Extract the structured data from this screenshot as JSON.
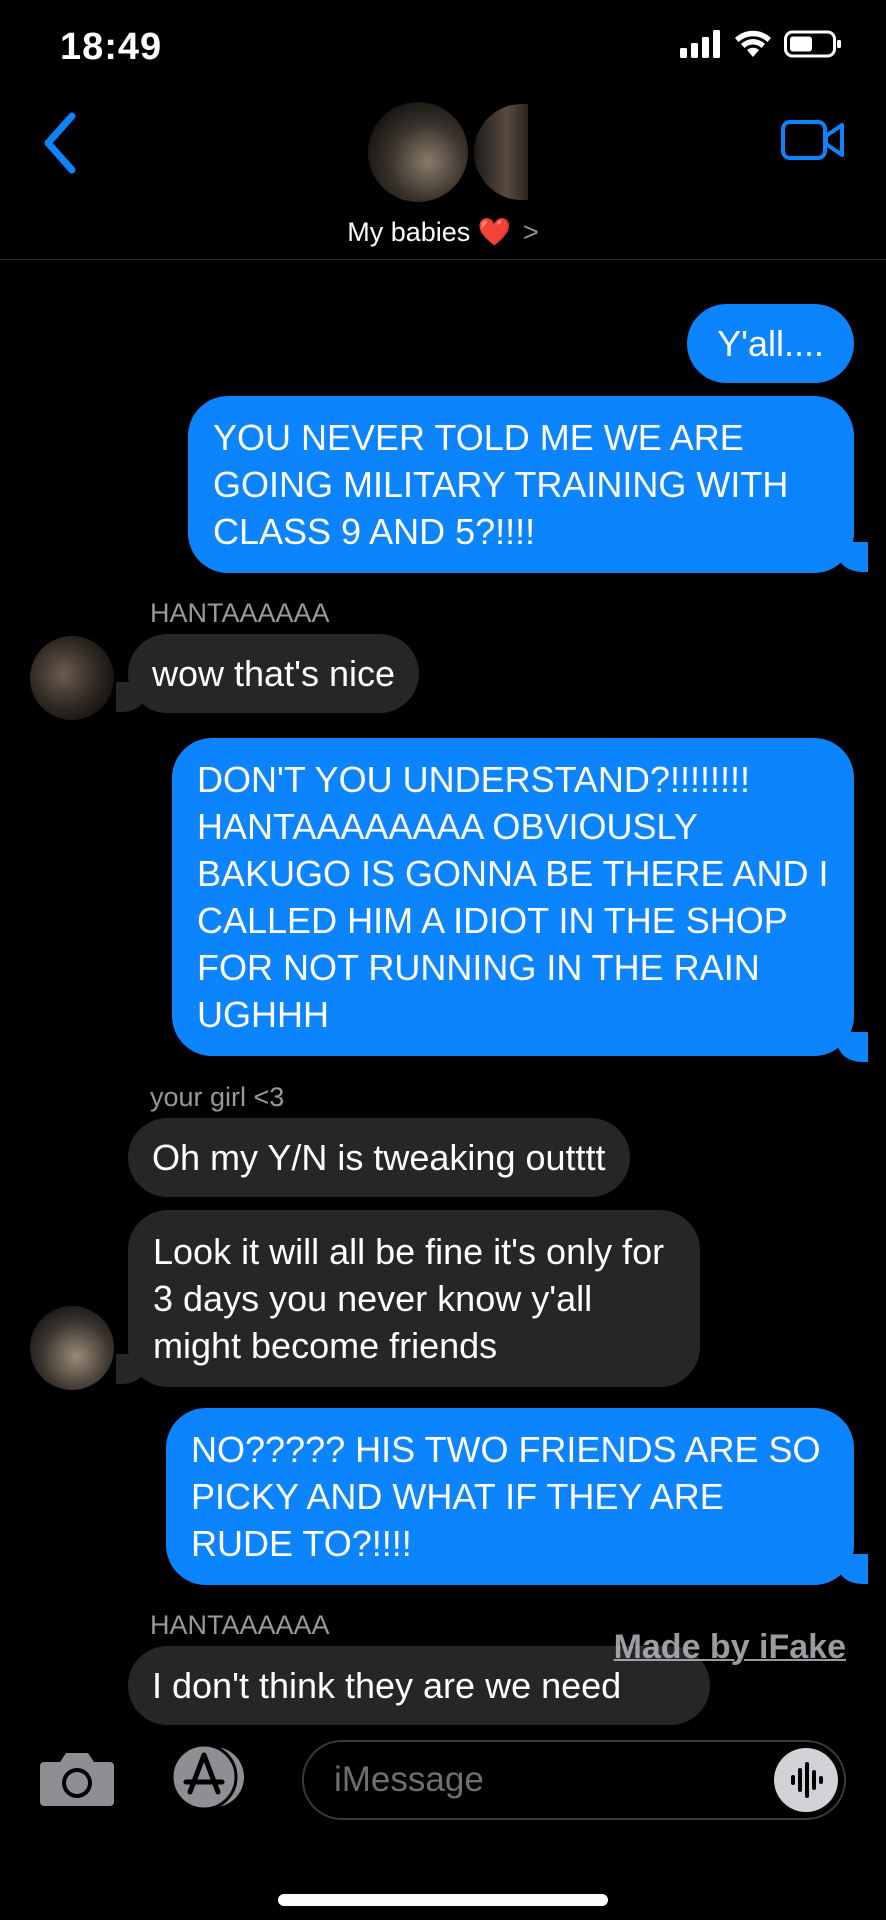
{
  "status_bar": {
    "time": "18:49"
  },
  "header": {
    "group_name": "My babies",
    "heart": "❤️",
    "chevron": ">"
  },
  "messages": [
    {
      "type": "out",
      "text": "Y'all...."
    },
    {
      "type": "out",
      "text": "YOU NEVER TOLD ME WE ARE GOING MILITARY TRAINING WITH CLASS 9 AND 5?!!!!"
    },
    {
      "type": "in",
      "sender": "HANTAAAAAA",
      "text": "wow that's nice"
    },
    {
      "type": "out",
      "text": "DON'T YOU UNDERSTAND?!!!!!!!! HANTAAAAAAAA OBVIOUSLY BAKUGO IS GONNA BE THERE AND I CALLED HIM A IDIOT IN THE SHOP FOR NOT RUNNING IN THE RAIN UGHHH"
    },
    {
      "type": "in",
      "sender": "your girl <3",
      "text": "Oh my Y/N is tweaking outttt"
    },
    {
      "type": "in",
      "text": "Look it will all be fine it's only for 3 days you never know y'all might become friends"
    },
    {
      "type": "out",
      "text": "NO????? HIS TWO FRIENDS ARE SO PICKY AND WHAT IF THEY ARE RUDE TO?!!!!"
    },
    {
      "type": "in",
      "sender": "HANTAAAAAA",
      "text": "I don't think they are we need"
    }
  ],
  "watermark": "Made by iFake",
  "compose": {
    "placeholder": "iMessage"
  },
  "colors": {
    "outgoing": "#0b84fe",
    "incoming": "#262628",
    "accent": "#0b84fe",
    "background": "#000000"
  }
}
